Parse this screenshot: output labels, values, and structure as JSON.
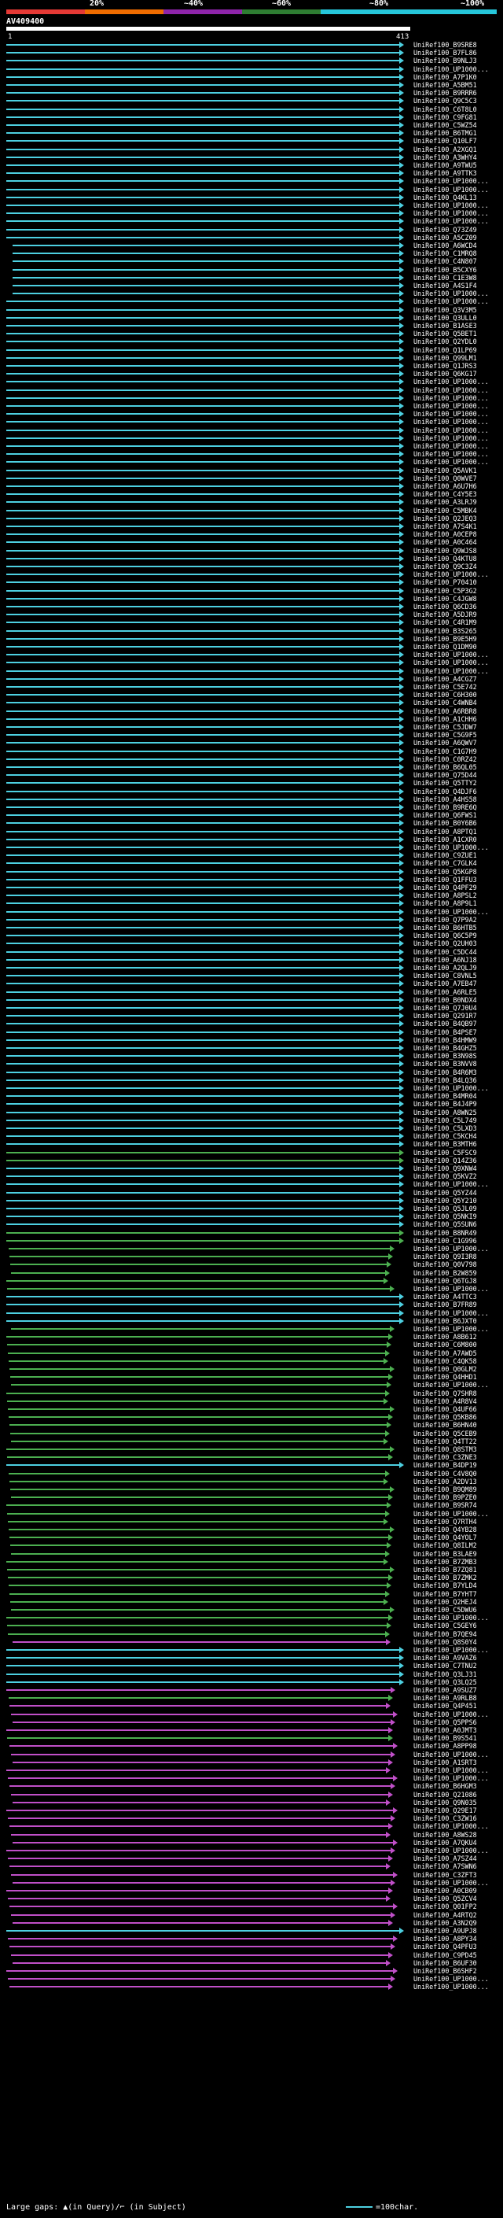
{
  "scale": {
    "labels": [
      "20%",
      "~40%",
      "~60%",
      "~80%",
      "~100%"
    ],
    "colors": [
      "#e53935",
      "#ef6c00",
      "#8e24aa",
      "#2e7d32",
      "#26c6da"
    ]
  },
  "query": {
    "title": "AV409400",
    "start_tick": "1",
    "end_tick": "413"
  },
  "hits": [
    {
      "name": "UniRef100_B9SRE8",
      "color": "cyan"
    },
    {
      "name": "UniRef100_B7FL86",
      "color": "cyan"
    },
    {
      "name": "UniRef100_B9NLJ3",
      "color": "cyan"
    },
    {
      "name": "UniRef100_UP1000...",
      "color": "cyan"
    },
    {
      "name": "UniRef100_A7P1K0",
      "color": "cyan"
    },
    {
      "name": "UniRef100_A5BM51",
      "color": "cyan"
    },
    {
      "name": "UniRef100_B9RRR6",
      "color": "cyan"
    },
    {
      "name": "UniRef100_Q9C5C3",
      "color": "cyan"
    },
    {
      "name": "UniRef100_C6T8L0",
      "color": "cyan"
    },
    {
      "name": "UniRef100_C9FG81",
      "color": "cyan"
    },
    {
      "name": "UniRef100_C5WZ54",
      "color": "cyan"
    },
    {
      "name": "UniRef100_B6TMG1",
      "color": "cyan"
    },
    {
      "name": "UniRef100_Q10LF7",
      "color": "cyan"
    },
    {
      "name": "UniRef100_A2XGQ1",
      "color": "cyan"
    },
    {
      "name": "UniRef100_A3WHY4",
      "color": "cyan"
    },
    {
      "name": "UniRef100_A9TWU5",
      "color": "cyan"
    },
    {
      "name": "UniRef100_A9TTK3",
      "color": "cyan"
    },
    {
      "name": "UniRef100_UP1000...",
      "color": "cyan"
    },
    {
      "name": "UniRef100_UP1000...",
      "color": "cyan"
    },
    {
      "name": "UniRef100_Q4KL13",
      "color": "cyan"
    },
    {
      "name": "UniRef100_UP1000...",
      "color": "cyan"
    },
    {
      "name": "UniRef100_UP1000...",
      "color": "cyan"
    },
    {
      "name": "UniRef100_UP1000...",
      "color": "cyan"
    },
    {
      "name": "UniRef100_Q73Z49",
      "color": "cyan"
    },
    {
      "name": "UniRef100_A5CZ09",
      "color": "cyan"
    },
    {
      "name": "UniRef100_A6WCD4",
      "color": "cyan"
    },
    {
      "name": "UniRef100_C1MRQ8",
      "color": "cyan"
    },
    {
      "name": "UniRef100_C4N807",
      "color": "cyan"
    },
    {
      "name": "UniRef100_B5CXY6",
      "color": "cyan"
    },
    {
      "name": "UniRef100_C1E3W8",
      "color": "cyan"
    },
    {
      "name": "UniRef100_A4S1F4",
      "color": "cyan"
    },
    {
      "name": "UniRef100_UP1000...",
      "color": "cyan"
    },
    {
      "name": "UniRef100_UP1000...",
      "color": "cyan"
    },
    {
      "name": "UniRef100_Q3V3M5",
      "color": "cyan"
    },
    {
      "name": "UniRef100_Q3ULL0",
      "color": "cyan"
    },
    {
      "name": "UniRef100_B1ASE3",
      "color": "cyan"
    },
    {
      "name": "UniRef100_Q5BET1",
      "color": "cyan"
    },
    {
      "name": "UniRef100_Q2YDL0",
      "color": "cyan"
    },
    {
      "name": "UniRef100_Q1LP69",
      "color": "cyan"
    },
    {
      "name": "UniRef100_Q99LM1",
      "color": "cyan"
    },
    {
      "name": "UniRef100_Q1JRS3",
      "color": "cyan"
    },
    {
      "name": "UniRef100_Q6KG17",
      "color": "cyan"
    },
    {
      "name": "UniRef100_UP1000...",
      "color": "cyan"
    },
    {
      "name": "UniRef100_UP1000...",
      "color": "cyan"
    },
    {
      "name": "UniRef100_UP1000...",
      "color": "cyan"
    },
    {
      "name": "UniRef100_UP1000...",
      "color": "cyan"
    },
    {
      "name": "UniRef100_UP1000...",
      "color": "cyan"
    },
    {
      "name": "UniRef100_UP1000...",
      "color": "cyan"
    },
    {
      "name": "UniRef100_UP1000...",
      "color": "cyan"
    },
    {
      "name": "UniRef100_UP1000...",
      "color": "cyan"
    },
    {
      "name": "UniRef100_UP1000...",
      "color": "cyan"
    },
    {
      "name": "UniRef100_UP1000...",
      "color": "cyan"
    },
    {
      "name": "UniRef100_UP1000...",
      "color": "cyan"
    },
    {
      "name": "UniRef100_Q5AVK1",
      "color": "cyan"
    },
    {
      "name": "UniRef100_Q0WVE7",
      "color": "cyan"
    },
    {
      "name": "UniRef100_A6U7H6",
      "color": "cyan"
    },
    {
      "name": "UniRef100_C4Y5E3",
      "color": "cyan"
    },
    {
      "name": "UniRef100_A3LRJ9",
      "color": "cyan"
    },
    {
      "name": "UniRef100_C5MBK4",
      "color": "cyan"
    },
    {
      "name": "UniRef100_Q2JEQ3",
      "color": "cyan"
    },
    {
      "name": "UniRef100_A7S4K1",
      "color": "cyan"
    },
    {
      "name": "UniRef100_A0CEP8",
      "color": "cyan"
    },
    {
      "name": "UniRef100_A0C464",
      "color": "cyan"
    },
    {
      "name": "UniRef100_Q9WJS8",
      "color": "cyan"
    },
    {
      "name": "UniRef100_Q4KTU8",
      "color": "cyan"
    },
    {
      "name": "UniRef100_Q9C3Z4",
      "color": "cyan"
    },
    {
      "name": "UniRef100_UP1000...",
      "color": "cyan"
    },
    {
      "name": "UniRef100_P70410",
      "color": "cyan"
    },
    {
      "name": "UniRef100_C5P3G2",
      "color": "cyan"
    },
    {
      "name": "UniRef100_C4JGW8",
      "color": "cyan"
    },
    {
      "name": "UniRef100_Q6CD36",
      "color": "cyan"
    },
    {
      "name": "UniRef100_A5DJR9",
      "color": "cyan"
    },
    {
      "name": "UniRef100_C4R1M9",
      "color": "cyan"
    },
    {
      "name": "UniRef100_B3S265",
      "color": "cyan"
    },
    {
      "name": "UniRef100_B9E5H9",
      "color": "cyan"
    },
    {
      "name": "UniRef100_Q1DM90",
      "color": "cyan"
    },
    {
      "name": "UniRef100_UP1000...",
      "color": "cyan"
    },
    {
      "name": "UniRef100_UP1000...",
      "color": "cyan"
    },
    {
      "name": "UniRef100_UP1000...",
      "color": "cyan"
    },
    {
      "name": "UniRef100_A4CGZ7",
      "color": "cyan"
    },
    {
      "name": "UniRef100_C5E742",
      "color": "cyan"
    },
    {
      "name": "UniRef100_C6H300",
      "color": "cyan"
    },
    {
      "name": "UniRef100_C4WNB4",
      "color": "cyan"
    },
    {
      "name": "UniRef100_A6RBR8",
      "color": "cyan"
    },
    {
      "name": "UniRef100_A1CHH6",
      "color": "cyan"
    },
    {
      "name": "UniRef100_C5JDW7",
      "color": "cyan"
    },
    {
      "name": "UniRef100_C5G9F5",
      "color": "cyan"
    },
    {
      "name": "UniRef100_A6QWV7",
      "color": "cyan"
    },
    {
      "name": "UniRef100_C1G7H9",
      "color": "cyan"
    },
    {
      "name": "UniRef100_C0RZ42",
      "color": "cyan"
    },
    {
      "name": "UniRef100_B6QL05",
      "color": "cyan"
    },
    {
      "name": "UniRef100_Q75D44",
      "color": "cyan"
    },
    {
      "name": "UniRef100_Q5TTY2",
      "color": "cyan"
    },
    {
      "name": "UniRef100_Q4DJF6",
      "color": "cyan"
    },
    {
      "name": "UniRef100_A4HS58",
      "color": "cyan"
    },
    {
      "name": "UniRef100_B9RE6Q",
      "color": "cyan"
    },
    {
      "name": "UniRef100_Q6FWS1",
      "color": "cyan"
    },
    {
      "name": "UniRef100_B0Y6B6",
      "color": "cyan"
    },
    {
      "name": "UniRef100_A8PTQ1",
      "color": "cyan"
    },
    {
      "name": "UniRef100_A1CXR0",
      "color": "cyan"
    },
    {
      "name": "UniRef100_UP1000...",
      "color": "cyan"
    },
    {
      "name": "UniRef100_C9ZUE1",
      "color": "cyan"
    },
    {
      "name": "UniRef100_C7GLK4",
      "color": "cyan"
    },
    {
      "name": "UniRef100_Q5KGP8",
      "color": "cyan"
    },
    {
      "name": "UniRef100_Q1FFU3",
      "color": "cyan"
    },
    {
      "name": "UniRef100_Q4PF29",
      "color": "cyan"
    },
    {
      "name": "UniRef100_A8PSL2",
      "color": "cyan"
    },
    {
      "name": "UniRef100_A8P9L1",
      "color": "cyan"
    },
    {
      "name": "UniRef100_UP1000...",
      "color": "cyan"
    },
    {
      "name": "UniRef100_Q7P9A2",
      "color": "cyan"
    },
    {
      "name": "UniRef100_B6HTB5",
      "color": "cyan"
    },
    {
      "name": "UniRef100_Q6C5P9",
      "color": "cyan"
    },
    {
      "name": "UniRef100_Q2UH03",
      "color": "cyan"
    },
    {
      "name": "UniRef100_C5DC44",
      "color": "cyan"
    },
    {
      "name": "UniRef100_A6NJ18",
      "color": "cyan"
    },
    {
      "name": "UniRef100_A2QLJ9",
      "color": "cyan"
    },
    {
      "name": "UniRef100_C8VNL5",
      "color": "cyan"
    },
    {
      "name": "UniRef100_A7EB47",
      "color": "cyan"
    },
    {
      "name": "UniRef100_A6RLE5",
      "color": "cyan"
    },
    {
      "name": "UniRef100_B0NDX4",
      "color": "cyan"
    },
    {
      "name": "UniRef100_Q7J0U4",
      "color": "cyan"
    },
    {
      "name": "UniRef100_Q291R7",
      "color": "cyan"
    },
    {
      "name": "UniRef100_B4QB97",
      "color": "cyan"
    },
    {
      "name": "UniRef100_B4PSE7",
      "color": "cyan"
    },
    {
      "name": "UniRef100_B4HMW9",
      "color": "cyan"
    },
    {
      "name": "UniRef100_B4GHZ5",
      "color": "cyan"
    },
    {
      "name": "UniRef100_B3N98S",
      "color": "cyan"
    },
    {
      "name": "UniRef100_B3NVV8",
      "color": "cyan"
    },
    {
      "name": "UniRef100_B4R6M3",
      "color": "cyan"
    },
    {
      "name": "UniRef100_B4LQ36",
      "color": "cyan"
    },
    {
      "name": "UniRef100_UP1000...",
      "color": "cyan"
    },
    {
      "name": "UniRef100_B4MR04",
      "color": "cyan"
    },
    {
      "name": "UniRef100_B4J4P9",
      "color": "cyan"
    },
    {
      "name": "UniRef100_A8WN25",
      "color": "cyan"
    },
    {
      "name": "UniRef100_C5L749",
      "color": "cyan"
    },
    {
      "name": "UniRef100_C5LXD3",
      "color": "cyan"
    },
    {
      "name": "UniRef100_C5KCH4",
      "color": "cyan"
    },
    {
      "name": "UniRef100_B3MTH6",
      "color": "cyan"
    },
    {
      "name": "UniRef100_C5FSC9",
      "color": "green"
    },
    {
      "name": "UniRef100_Q14Z36",
      "color": "green"
    },
    {
      "name": "UniRef100_Q9XNW4",
      "color": "cyan"
    },
    {
      "name": "UniRef100_Q5KVZ2",
      "color": "cyan"
    },
    {
      "name": "UniRef100_UP1000...",
      "color": "cyan"
    },
    {
      "name": "UniRef100_Q5YZ44",
      "color": "cyan"
    },
    {
      "name": "UniRef100_Q5Y210",
      "color": "cyan"
    },
    {
      "name": "UniRef100_Q5JL09",
      "color": "cyan"
    },
    {
      "name": "UniRef100_Q5NKI9",
      "color": "cyan"
    },
    {
      "name": "UniRef100_Q5SUN6",
      "color": "cyan"
    },
    {
      "name": "UniRef100_B8NR49",
      "color": "green"
    },
    {
      "name": "UniRef100_C1G996",
      "color": "green"
    },
    {
      "name": "UniRef100_UP1000...",
      "color": "green"
    },
    {
      "name": "UniRef100_Q9I3R8",
      "color": "green"
    },
    {
      "name": "UniRef100_Q0V798",
      "color": "green"
    },
    {
      "name": "UniRef100_B2W859",
      "color": "green"
    },
    {
      "name": "UniRef100_Q6TGJ8",
      "color": "green"
    },
    {
      "name": "UniRef100_UP1000...",
      "color": "green"
    },
    {
      "name": "UniRef100_A4TTC3",
      "color": "cyan"
    },
    {
      "name": "UniRef100_B7FR89",
      "color": "cyan"
    },
    {
      "name": "UniRef100_UP1000...",
      "color": "cyan"
    },
    {
      "name": "UniRef100_B6JXT0",
      "color": "cyan"
    },
    {
      "name": "UniRef100_UP1000...",
      "color": "green"
    },
    {
      "name": "UniRef100_A8B612",
      "color": "green"
    },
    {
      "name": "UniRef100_C6M800",
      "color": "green"
    },
    {
      "name": "UniRef100_A7AWD5",
      "color": "green"
    },
    {
      "name": "UniRef100_C4QK58",
      "color": "green"
    },
    {
      "name": "UniRef100_Q0GLM2",
      "color": "green"
    },
    {
      "name": "UniRef100_Q4HHD1",
      "color": "green"
    },
    {
      "name": "UniRef100_UP1000...",
      "color": "green"
    },
    {
      "name": "UniRef100_Q7SHR8",
      "color": "green"
    },
    {
      "name": "UniRef100_A4R8V4",
      "color": "green"
    },
    {
      "name": "UniRef100_Q4UF66",
      "color": "green"
    },
    {
      "name": "UniRef100_Q5KB86",
      "color": "green"
    },
    {
      "name": "UniRef100_B6HN40",
      "color": "green"
    },
    {
      "name": "UniRef100_Q5CEB9",
      "color": "green"
    },
    {
      "name": "UniRef100_Q4TT22",
      "color": "green"
    },
    {
      "name": "UniRef100_Q8STM3",
      "color": "green"
    },
    {
      "name": "UniRef100_C3ZNE3",
      "color": "green"
    },
    {
      "name": "UniRef100_B4DP19",
      "color": "cyan"
    },
    {
      "name": "UniRef100_C4V8Q0",
      "color": "green"
    },
    {
      "name": "UniRef100_A2DV13",
      "color": "green"
    },
    {
      "name": "UniRef100_B9QM89",
      "color": "green"
    },
    {
      "name": "UniRef100_B9PZE0",
      "color": "green"
    },
    {
      "name": "UniRef100_B9SR74",
      "color": "green"
    },
    {
      "name": "UniRef100_UP1000...",
      "color": "green"
    },
    {
      "name": "UniRef100_Q7RTH4",
      "color": "green"
    },
    {
      "name": "UniRef100_Q4YB28",
      "color": "green"
    },
    {
      "name": "UniRef100_Q4YOL7",
      "color": "green"
    },
    {
      "name": "UniRef100_Q8ILM2",
      "color": "green"
    },
    {
      "name": "UniRef100_B3LAE9",
      "color": "green"
    },
    {
      "name": "UniRef100_B7ZMB3",
      "color": "green"
    },
    {
      "name": "UniRef100_B7ZQ81",
      "color": "green"
    },
    {
      "name": "UniRef100_B7ZMK2",
      "color": "green"
    },
    {
      "name": "UniRef100_B7YLD4",
      "color": "green"
    },
    {
      "name": "UniRef100_B7YHT7",
      "color": "green"
    },
    {
      "name": "UniRef100_Q2HEJ4",
      "color": "green"
    },
    {
      "name": "UniRef100_C5DWU6",
      "color": "green"
    },
    {
      "name": "UniRef100_UP1000...",
      "color": "green"
    },
    {
      "name": "UniRef100_C5GEY6",
      "color": "green"
    },
    {
      "name": "UniRef100_B7QE94",
      "color": "green"
    },
    {
      "name": "UniRef100_Q8S0Y4",
      "color": "magenta"
    },
    {
      "name": "UniRef100_UP1000...",
      "color": "cyan"
    },
    {
      "name": "UniRef100_A9VAZ6",
      "color": "cyan"
    },
    {
      "name": "UniRef100_C7TNU2",
      "color": "cyan"
    },
    {
      "name": "UniRef100_Q3LJ31",
      "color": "cyan"
    },
    {
      "name": "UniRef100_Q3LQ25",
      "color": "cyan"
    },
    {
      "name": "UniRef100_A9SUZ7",
      "color": "magenta"
    },
    {
      "name": "UniRef100_A9RLB8",
      "color": "green"
    },
    {
      "name": "UniRef100_Q4P451",
      "color": "magenta"
    },
    {
      "name": "UniRef100_UP1000...",
      "color": "magenta"
    },
    {
      "name": "UniRef100_Q5PPS6",
      "color": "magenta"
    },
    {
      "name": "UniRef100_A0JMT3",
      "color": "magenta"
    },
    {
      "name": "UniRef100_B9S541",
      "color": "green"
    },
    {
      "name": "UniRef100_A8PP98",
      "color": "magenta"
    },
    {
      "name": "UniRef100_UP1000...",
      "color": "magenta"
    },
    {
      "name": "UniRef100_A1SRT3",
      "color": "magenta"
    },
    {
      "name": "UniRef100_UP1000...",
      "color": "magenta"
    },
    {
      "name": "UniRef100_UP1000...",
      "color": "magenta"
    },
    {
      "name": "UniRef100_B6HGM3",
      "color": "magenta"
    },
    {
      "name": "UniRef100_Q21086",
      "color": "magenta"
    },
    {
      "name": "UniRef100_Q9N035",
      "color": "magenta"
    },
    {
      "name": "UniRef100_Q29E17",
      "color": "magenta"
    },
    {
      "name": "UniRef100_C3ZW16",
      "color": "magenta"
    },
    {
      "name": "UniRef100_UP1000...",
      "color": "magenta"
    },
    {
      "name": "UniRef100_A8WS28",
      "color": "magenta"
    },
    {
      "name": "UniRef100_A7QKU4",
      "color": "magenta"
    },
    {
      "name": "UniRef100_UP1000...",
      "color": "magenta"
    },
    {
      "name": "UniRef100_A7SZ44",
      "color": "magenta"
    },
    {
      "name": "UniRef100_A7SWN6",
      "color": "magenta"
    },
    {
      "name": "UniRef100_C3ZFT3",
      "color": "magenta"
    },
    {
      "name": "UniRef100_UP1000...",
      "color": "magenta"
    },
    {
      "name": "UniRef100_A0CB09",
      "color": "magenta"
    },
    {
      "name": "UniRef100_Q5ZCV4",
      "color": "magenta"
    },
    {
      "name": "UniRef100_Q01FP2",
      "color": "magenta"
    },
    {
      "name": "UniRef100_A4RTQ2",
      "color": "magenta"
    },
    {
      "name": "UniRef100_A3N2Q9",
      "color": "magenta"
    },
    {
      "name": "UniRef100_A9UPJ8",
      "color": "cyan"
    },
    {
      "name": "UniRef100_A8PY34",
      "color": "magenta"
    },
    {
      "name": "UniRef100_Q4PFU3",
      "color": "magenta"
    },
    {
      "name": "UniRef100_C9PD45",
      "color": "magenta"
    },
    {
      "name": "UniRef100_B6UF30",
      "color": "magenta"
    },
    {
      "name": "UniRef100_B6SHF2",
      "color": "magenta"
    },
    {
      "name": "UniRef100_UP1000...",
      "color": "magenta"
    },
    {
      "name": "UniRef100_UP1000...",
      "color": "magenta"
    }
  ],
  "footer": {
    "text": "Large gaps: ▲(in Query)/⌐ (in Subject)",
    "legend_text": "=100char."
  },
  "colors": {
    "cyan": "#4dd0e1",
    "green": "#4caf50",
    "magenta": "#c04fc8"
  }
}
